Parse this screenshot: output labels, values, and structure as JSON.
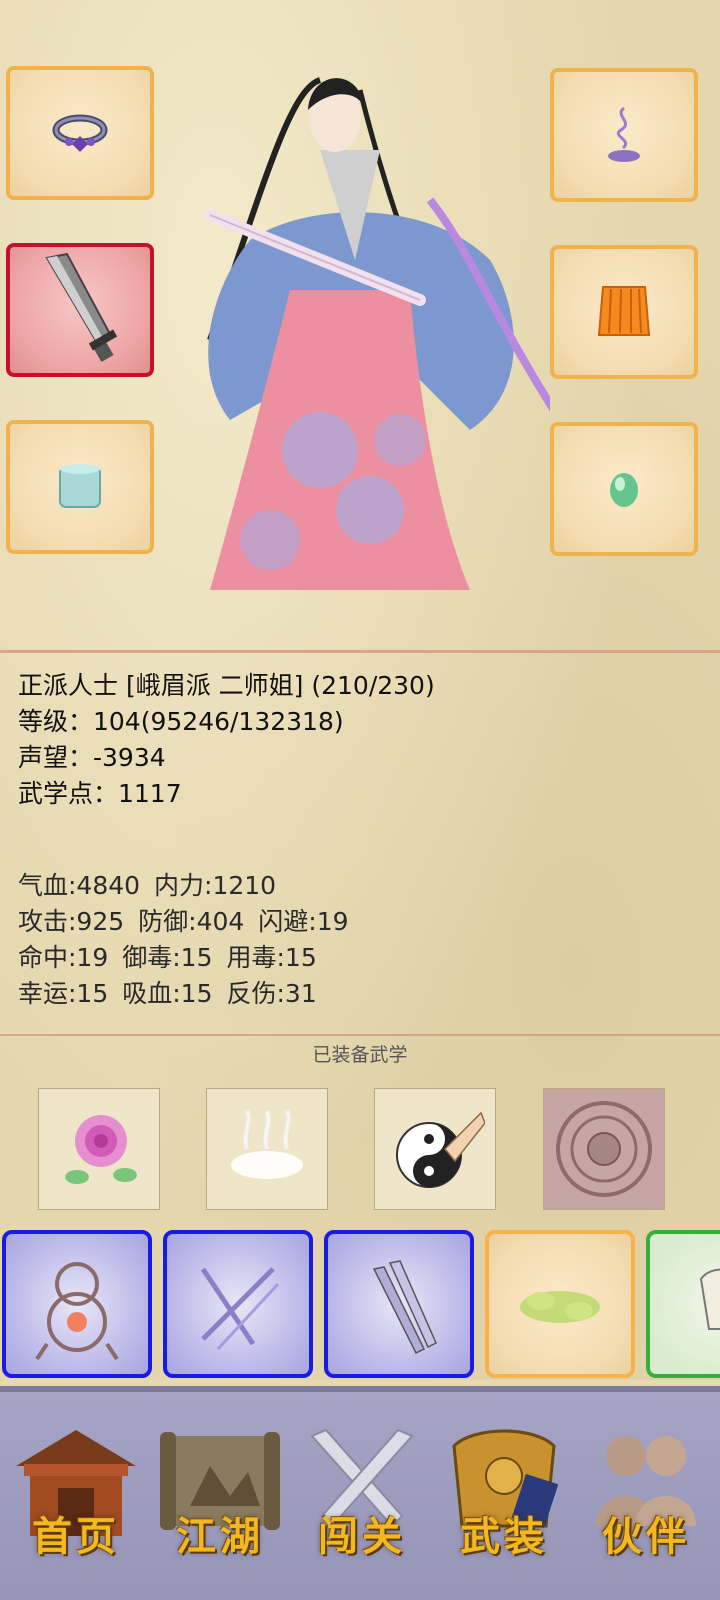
{
  "character": {
    "line1": "正派人士 [峨眉派 二师姐] (210/230)",
    "level": "等级：104(95246/132318)",
    "reputation": "声望：-3934",
    "martial_points": "武学点：1117"
  },
  "stats": {
    "hp": "气血:4840",
    "internal": "内力:1210",
    "attack": "攻击:925",
    "defense": "防御:404",
    "dodge": "闪避:19",
    "hit": "命中:19",
    "poison_resist": "御毒:15",
    "poison_use": "用毒:15",
    "luck": "幸运:15",
    "lifesteal": "吸血:15",
    "reflect": "反伤:31"
  },
  "equipped_martial_arts_label": "已装备武学",
  "nav": {
    "home": "首页",
    "jianghu": "江湖",
    "challenge": "闯关",
    "equipment": "武装",
    "partner": "伙伴"
  },
  "colors": {
    "slot_border": "#f0b24a",
    "active_border": "#c8102e",
    "blue_border": "#1a1ae6",
    "green_border": "#34b13a",
    "nav_text": "#f2b81e"
  }
}
